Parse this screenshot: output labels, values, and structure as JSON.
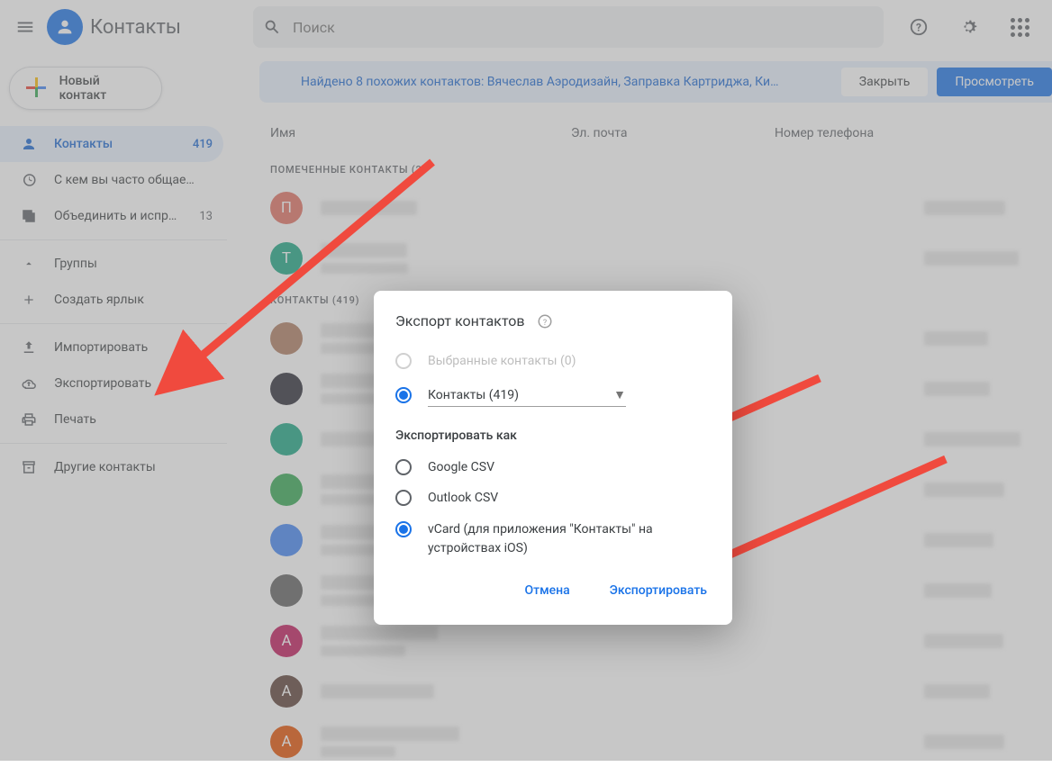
{
  "app": {
    "title": "Контакты"
  },
  "search": {
    "placeholder": "Поиск"
  },
  "create": {
    "label": "Новый контакт"
  },
  "sidebar": {
    "items": [
      {
        "icon": "person-icon",
        "label": "Контакты",
        "badge": "419",
        "active": true
      },
      {
        "icon": "history-icon",
        "label": "С кем вы часто общае…",
        "badge": ""
      },
      {
        "icon": "merge-icon",
        "label": "Объединить и испр…",
        "badge": "13"
      }
    ],
    "groups_label": "Группы",
    "create_label_label": "Создать ярлык",
    "actions": [
      {
        "icon": "upload-icon",
        "label": "Импортировать"
      },
      {
        "icon": "cloud-icon",
        "label": "Экспортировать"
      },
      {
        "icon": "print-icon",
        "label": "Печать"
      }
    ],
    "other_label": "Другие контакты"
  },
  "notice": {
    "text": "Найдено 8 похожих контактов: Вячеслав Аэродизайн, Заправка Картриджа, Ки…",
    "close": "Закрыть",
    "view": "Просмотреть"
  },
  "columns": {
    "name": "Имя",
    "email": "Эл. почта",
    "phone": "Номер телефона"
  },
  "sections": {
    "starred": "ПОМЕЧЕННЫЕ КОНТАКТЫ (2)",
    "contacts": "КОНТАКТЫ (419)"
  },
  "rows": {
    "starred": [
      {
        "letter": "П",
        "color": "#e27061"
      },
      {
        "letter": "Т",
        "color": "#1aa783"
      }
    ],
    "contacts": [
      {
        "letter": "",
        "color": "#b07d62",
        "image": true
      },
      {
        "letter": "",
        "color": "#2a2a36",
        "image": true
      },
      {
        "letter": "",
        "color": "#1aa783"
      },
      {
        "letter": "",
        "color": "#34a853"
      },
      {
        "letter": "",
        "color": "#4285f4"
      },
      {
        "letter": "",
        "color": "#616161"
      },
      {
        "letter": "А",
        "color": "#c2185b"
      },
      {
        "letter": "А",
        "color": "#5d4037"
      },
      {
        "letter": "А",
        "color": "#e65100"
      }
    ]
  },
  "dialog": {
    "title": "Экспорт контактов",
    "opt_selected": "Выбранные контакты (0)",
    "opt_all": "Контакты (419)",
    "export_as": "Экспортировать как",
    "fmt_google": "Google CSV",
    "fmt_outlook": "Outlook CSV",
    "fmt_vcard": "vCard (для приложения \"Контакты\" на устройствах iOS)",
    "cancel": "Отмена",
    "export": "Экспортировать"
  }
}
